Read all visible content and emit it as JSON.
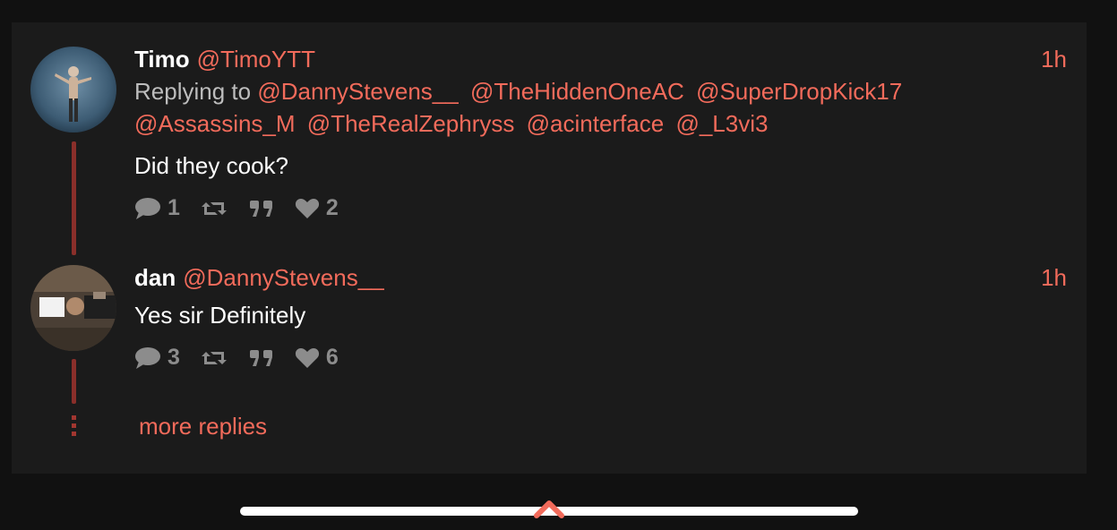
{
  "posts": [
    {
      "display_name": "Timo",
      "handle": "@TimoYTT",
      "time": "1h",
      "replying_label": "Replying to",
      "mentions": [
        "@DannyStevens__",
        "@TheHiddenOneAC",
        "@SuperDropKick17",
        "@Assassins_M",
        "@TheRealZephryss",
        "@acinterface",
        "@_L3vi3"
      ],
      "text": "Did they cook?",
      "replies": "1",
      "likes": "2",
      "avatar_icon": "person-photo"
    },
    {
      "display_name": "dan",
      "handle": "@DannyStevens__",
      "time": "1h",
      "text": "Yes sir Definitely",
      "replies": "3",
      "likes": "6",
      "avatar_icon": "person-photo"
    }
  ],
  "more_replies": "more replies",
  "colors": {
    "accent": "#f26b5b",
    "thread_line": "#8a2f2a",
    "card_bg": "#1b1b1b",
    "page_bg": "#111111",
    "action_gray": "#8c8c8c"
  },
  "icons": [
    "comment-icon",
    "repost-icon",
    "quote-icon",
    "heart-icon",
    "chevron-up-icon"
  ]
}
